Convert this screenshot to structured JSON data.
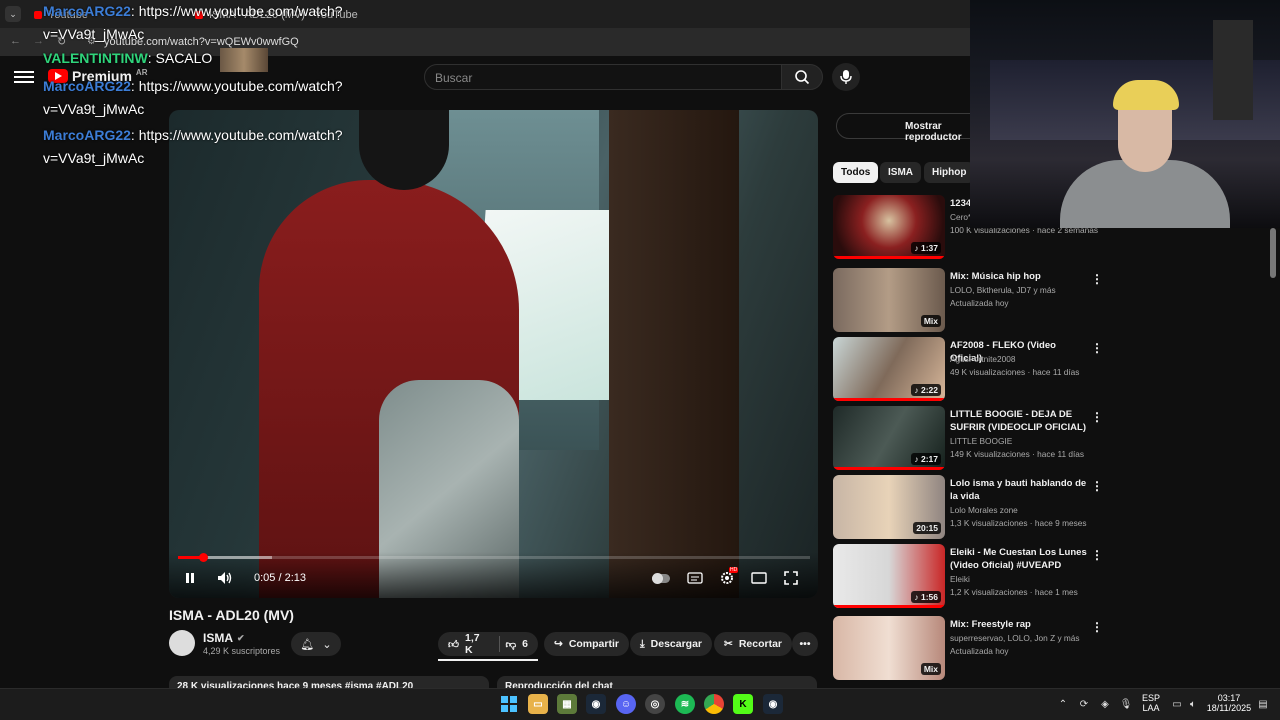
{
  "browser": {
    "tabs": [
      {
        "label": "Youtube"
      },
      {
        "label": "ISMA - ADL20 (MV) - YouTube"
      }
    ],
    "url": "youtube.com/watch?v=wQEWv0wwfGQ"
  },
  "chat": [
    {
      "user": "MarcoARG22",
      "sep": ":",
      "msg": " https://www.youtube.com/watch?",
      "cont": "v=VVa9t_jMwAc"
    },
    {
      "user": "VALENTINTINW",
      "sep": ":",
      "msg": " SACALO"
    },
    {
      "user": "MarcoARG22",
      "sep": ":",
      "msg": " https://www.youtube.com/watch?",
      "cont": "v=VVa9t_jMwAc"
    },
    {
      "user": "MarcoARG22",
      "sep": ":",
      "msg": " https://www.youtube.com/watch?",
      "cont": "v=VVa9t_jMwAc"
    }
  ],
  "header": {
    "logo": "Premium",
    "region": "AR",
    "search_placeholder": "Buscar"
  },
  "player": {
    "time": "0:05 / 2:13",
    "progress": 0.039,
    "buffered": 0.149,
    "settings_badge": "HD"
  },
  "video": {
    "title": "ISMA - ADL20 (MV)",
    "channel": "ISMA",
    "subscribers": "4,29 K suscriptores",
    "likes": "1,7 K",
    "dislikes": "6",
    "share": "Compartir",
    "download": "Descargar",
    "clip": "Recortar",
    "desc_summary": "28 K visualizaciones  hace 9 meses  #isma #ADL20",
    "chat_replay": "Reproducción del chat"
  },
  "sidebar": {
    "mostrar": "Mostrar reproductor",
    "chips": [
      "Todos",
      "ISMA",
      "Hiphop"
    ],
    "recs": [
      {
        "title": "1234",
        "channel": "Cero*",
        "meta": "100 K visualizaciones · hace 2 semanas",
        "dur": "♪ 1:37"
      },
      {
        "title": "Mix: Música hip hop",
        "channel": "LOLO, Bktherula, JD7 y más",
        "meta": "Actualizada hoy",
        "dur": "Mix"
      },
      {
        "title": "AF2008 - FLEKO (Video Oficial)",
        "channel": "AgusFortnite2008",
        "meta": "49 K visualizaciones · hace 11 días",
        "dur": "♪ 2:22"
      },
      {
        "title": "LITTLE BOOGIE - DEJA DE SUFRIR (VIDEOCLIP OFICIAL)",
        "channel": "LITTLE BOOGIE",
        "meta": "149 K visualizaciones · hace 11 días",
        "dur": "♪ 2:17"
      },
      {
        "title": "Lolo isma y bauti hablando de la vida",
        "channel": "Lolo Morales zone",
        "meta": "1,3 K visualizaciones · hace 9 meses",
        "dur": "20:15"
      },
      {
        "title": "Eleiki - Me Cuestan Los Lunes (Video Oficial) #UVEAPD",
        "channel": "Eleiki",
        "meta": "1,2 K visualizaciones · hace 1 mes",
        "dur": "♪ 1:56"
      },
      {
        "title": "Mix: Freestyle rap",
        "channel": "superreservao, LOLO, Jon Z y más",
        "meta": "Actualizada hoy",
        "dur": "Mix"
      }
    ]
  },
  "taskbar": {
    "lang1": "ESP",
    "lang2": "LAA",
    "time": "03:17",
    "date": "18/11/2025"
  },
  "colors": {
    "accent": "#ff0000",
    "chat_user1": "#3c7dd6",
    "chat_user2": "#2fd47b"
  }
}
